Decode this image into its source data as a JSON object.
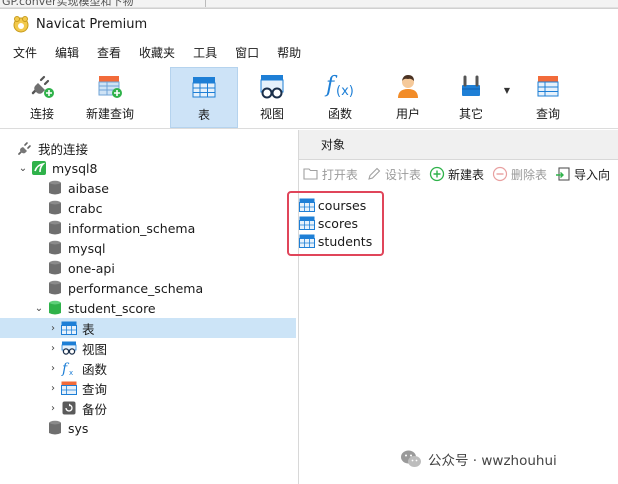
{
  "background_window": {
    "title_fragment": "GP.conver实现模型和下物"
  },
  "app": {
    "title": "Navicat Premium"
  },
  "menu": [
    "文件",
    "编辑",
    "查看",
    "收藏夹",
    "工具",
    "窗口",
    "帮助"
  ],
  "toolbar": {
    "connect": "连接",
    "new_query": "新建查询",
    "table": "表",
    "view": "视图",
    "function": "函数",
    "user": "用户",
    "other": "其它",
    "query": "查询"
  },
  "sidebar": {
    "my_connections": "我的连接",
    "connection": "mysql8",
    "databases": [
      "aibase",
      "crabc",
      "information_schema",
      "mysql",
      "one-api",
      "performance_schema"
    ],
    "open_db": "student_score",
    "open_db_children": [
      "表",
      "视图",
      "函数",
      "查询",
      "备份"
    ],
    "last_db": "sys"
  },
  "main": {
    "tab": "对象",
    "actions": {
      "open_table": "打开表",
      "design_table": "设计表",
      "new_table": "新建表",
      "delete_table": "删除表",
      "import": "导入向"
    },
    "tables": [
      "courses",
      "scores",
      "students"
    ]
  },
  "watermark": {
    "text": "公众号 · wwzhouhui"
  },
  "colors": {
    "selected_bg": "#cce4f7",
    "highlight_border": "#e0455a",
    "accent_blue": "#1e7fd6"
  }
}
